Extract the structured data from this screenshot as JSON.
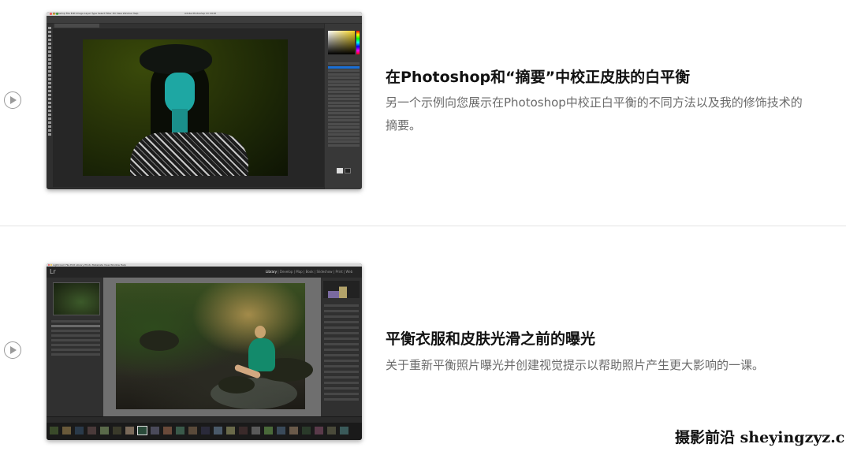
{
  "lessons": [
    {
      "title": "在Photoshop和“摘要”中校正皮肤的白平衡",
      "description": "另一个示例向您展示在Photoshop中校正白平衡的不同方法以及我的修饰技术的摘要。",
      "thumbnail": {
        "app": "Adobe Photoshop",
        "menu": "Photoshop  File  Edit  Image  Layer  Type  Select  Filter  3D  View  Window  Help",
        "window_title": "Adobe Photoshop CC 2018"
      }
    },
    {
      "title": "平衡衣服和皮肤光滑之前的曝光",
      "description": "关于重新平衡照片曝光并创建视觉提示以帮助照片产生更大影响的一课。",
      "thumbnail": {
        "app": "Adobe Lightroom",
        "menu": "Lightroom  File  Edit  Library  Photo  Metadata  View  Window  Help",
        "logo": "Lr",
        "modules": [
          "Library",
          "Develop",
          "Map",
          "Book",
          "Slideshow",
          "Print",
          "Web"
        ],
        "active_module": "Library"
      }
    }
  ],
  "watermark": {
    "text": "摄影前沿 sheyingzyz.com"
  },
  "icons": {
    "play": "play-circle-icon"
  },
  "colors": {
    "title": "#111111",
    "description": "#6b6b6b",
    "play_icon": "#9a9a9a",
    "divider": "#e4e4e4"
  }
}
